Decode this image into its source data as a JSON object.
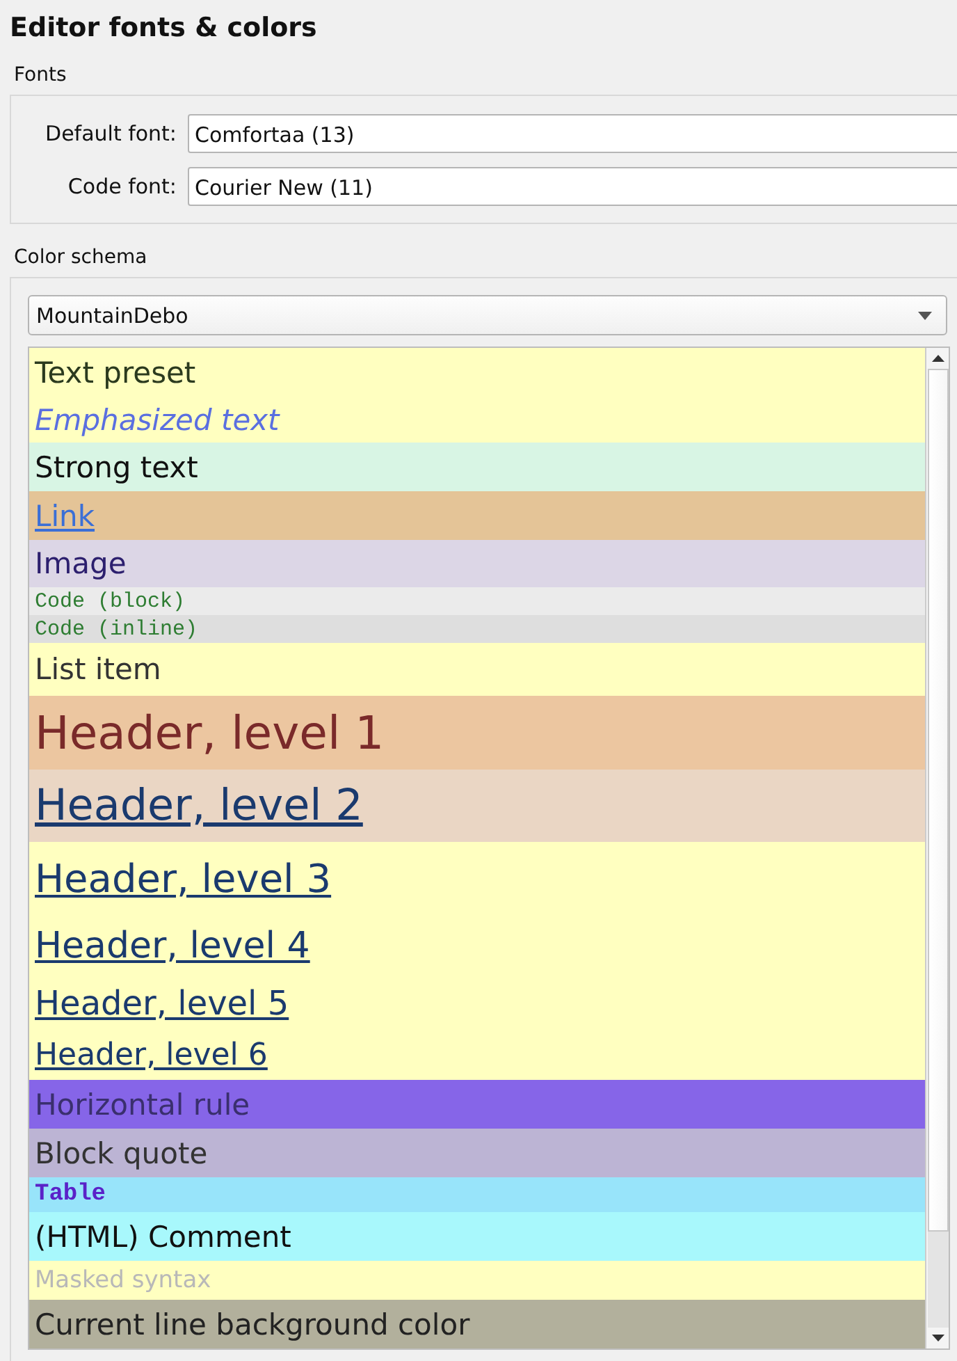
{
  "title": "Editor fonts & colors",
  "fonts": {
    "label": "Fonts",
    "fields": [
      {
        "label": "Default font:",
        "value": "Comfortaa (13)"
      },
      {
        "label": "Code font:",
        "value": "Courier New (11)"
      }
    ]
  },
  "color_schema": {
    "label": "Color schema",
    "dropdown": {
      "value": "MountainDebo"
    },
    "items": [
      {
        "label": "Text preset",
        "kind": "preset",
        "color": "#ffffc0"
      },
      {
        "label": "Emphasized text",
        "kind": "emphasis",
        "color": "#ffffc0"
      },
      {
        "label": "Strong text",
        "kind": "strong",
        "color": "#d8f5e4"
      },
      {
        "label": "Link",
        "kind": "link",
        "color": "#e4c497"
      },
      {
        "label": "Image",
        "kind": "image",
        "color": "#dcd6e6"
      },
      {
        "label": "Code (block)",
        "kind": "code",
        "color": "#ebebeb"
      },
      {
        "label": "Code (inline)",
        "kind": "code",
        "color": "#dedede"
      },
      {
        "label": "List item",
        "kind": "list",
        "color": "#ffffc0"
      },
      {
        "label": "Header, level 1",
        "kind": "h1",
        "color": "#ecc6a0"
      },
      {
        "label": "Header, level 2",
        "kind": "h2",
        "color": "#ead6c4"
      },
      {
        "label": "Header, level 3",
        "kind": "h3",
        "color": "#ffffc0"
      },
      {
        "label": "Header, level 4",
        "kind": "h4",
        "color": "#ffffc0"
      },
      {
        "label": "Header, level 5",
        "kind": "h5",
        "color": "#ffffc0"
      },
      {
        "label": "Header, level 6",
        "kind": "h6",
        "color": "#ffffc0"
      },
      {
        "label": "Horizontal rule",
        "kind": "rule",
        "color": "#8665e8"
      },
      {
        "label": "Block quote",
        "kind": "quote",
        "color": "#bcb4d4"
      },
      {
        "label": "Table",
        "kind": "table",
        "color": "#98e4fa"
      },
      {
        "label": "(HTML) Comment",
        "kind": "comment",
        "color": "#a8f8fc"
      },
      {
        "label": "Masked syntax",
        "kind": "masked",
        "color": "#ffffc0"
      },
      {
        "label": "Current line background color",
        "kind": "current",
        "color": "#b2b09c"
      }
    ]
  }
}
